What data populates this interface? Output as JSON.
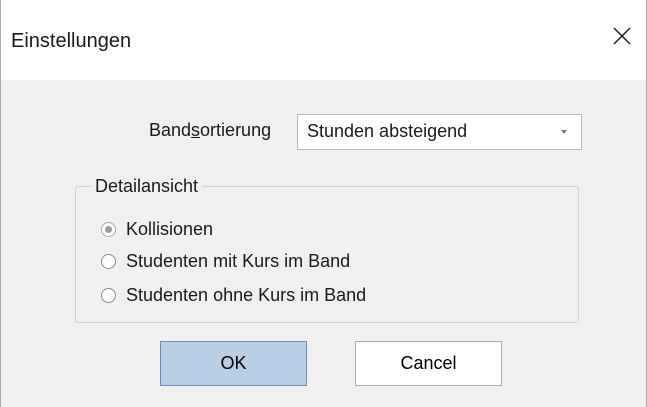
{
  "window": {
    "title": "Einstellungen",
    "close_icon": "close-icon"
  },
  "sorting": {
    "label_prefix": "Band",
    "label_mnemonic": "s",
    "label_suffix": "ortierung",
    "selected_value": "Stunden absteigend",
    "arrow_icon": "chevron-down-icon"
  },
  "detail_view": {
    "legend": "Detailansicht",
    "options": [
      {
        "label": "Kollisionen",
        "checked": true
      },
      {
        "label": "Studenten mit Kurs im Band",
        "checked": false
      },
      {
        "label": "Studenten ohne Kurs im Band",
        "checked": false
      }
    ]
  },
  "buttons": {
    "ok_label": "OK",
    "cancel_label": "Cancel"
  },
  "colors": {
    "dialog_bg": "#f0f0f0",
    "ok_button_bg": "#b8cfe6",
    "ok_button_border": "#6a8fc0"
  }
}
